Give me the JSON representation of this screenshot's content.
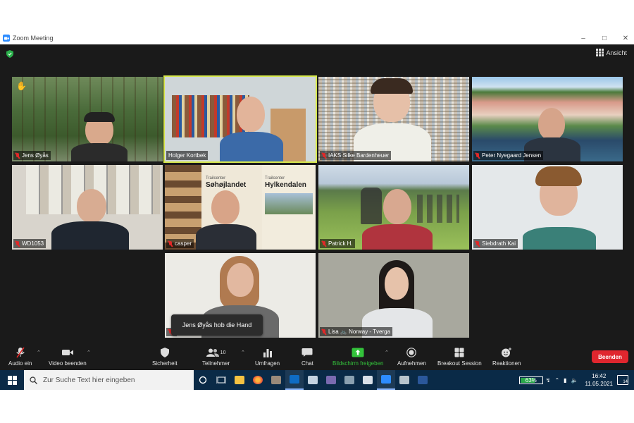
{
  "window": {
    "title": "Zoom Meeting"
  },
  "meeting": {
    "view_label": "Ansicht"
  },
  "participants": [
    {
      "name": "Jens Øyås",
      "muted": true,
      "hand_raised": true
    },
    {
      "name": "Holger Kortbek",
      "muted": false,
      "active_speaker": true
    },
    {
      "name": "IAKS Silke Bardenheuer",
      "muted": true
    },
    {
      "name": "Peter Nyegaard Jensen",
      "muted": true
    },
    {
      "name": "WD1053",
      "muted": true
    },
    {
      "name": "casper",
      "muted": true,
      "backdrop_text": [
        "Trailcenter",
        "Søhøjlandet",
        "Trailcenter",
        "Hylkendalen"
      ]
    },
    {
      "name": "Patrick H.",
      "muted": true
    },
    {
      "name": "Siebdrath Kai",
      "muted": true
    },
    {
      "name": "",
      "muted": true
    },
    {
      "name": "Lisa 🚲 Norway - Tverga",
      "muted": true
    }
  ],
  "notification": "Jens Øyås hob die Hand",
  "toolbar": {
    "audio": "Audio ein",
    "video": "Video beenden",
    "security": "Sicherheit",
    "participants": "Teilnehmer",
    "participants_count": "10",
    "polls": "Umfragen",
    "chat": "Chat",
    "share": "Bildschirm freigeben",
    "record": "Aufnehmen",
    "breakout": "Breakout Session",
    "reactions": "Reaktionen",
    "end": "Beenden"
  },
  "taskbar": {
    "search_placeholder": "Zur Suche Text hier eingeben",
    "battery": "63%",
    "time": "16:42",
    "date": "11.05.2021",
    "notifications": "14"
  },
  "colors": {
    "meeting_bg": "#1a1a1a",
    "active_speaker_border": "#d7e84d",
    "muted_red": "#e02828",
    "share_green": "#33c33b",
    "end_red": "#e0262e",
    "taskbar": "#0a2a47"
  }
}
